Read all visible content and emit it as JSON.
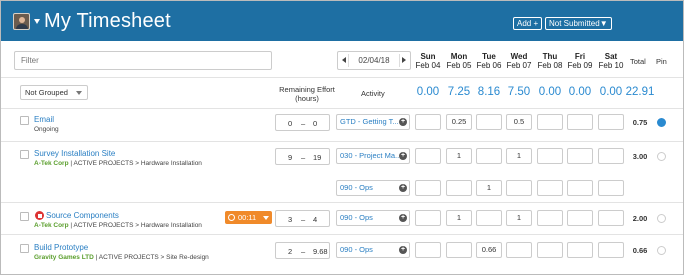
{
  "header": {
    "title": "My Timesheet",
    "add_label": "Add +",
    "status_label": "Not Submitted▼"
  },
  "toolbar": {
    "filter_placeholder": "Filter",
    "date": "02/04/18"
  },
  "days": [
    {
      "name": "Sun",
      "date": "Feb 04",
      "total": "0.00"
    },
    {
      "name": "Mon",
      "date": "Feb 05",
      "total": "7.25"
    },
    {
      "name": "Tue",
      "date": "Feb 06",
      "total": "8.16"
    },
    {
      "name": "Wed",
      "date": "Feb 07",
      "total": "7.50"
    },
    {
      "name": "Thu",
      "date": "Feb 08",
      "total": "0.00"
    },
    {
      "name": "Fri",
      "date": "Feb 09",
      "total": "0.00"
    },
    {
      "name": "Sat",
      "date": "Feb 10",
      "total": "0.00"
    }
  ],
  "columns": {
    "total": "Total",
    "pin": "Pin",
    "remaining": "Remaining Effort",
    "remaining_unit": "(hours)",
    "activity": "Activity",
    "grouping": "Not Grouped"
  },
  "grand_total": "22.91",
  "rows": [
    {
      "task": "Email",
      "sub_client": "",
      "sub_path": "Ongoing",
      "rem_a": "0",
      "rem_b": "0",
      "activities": [
        {
          "label": "GTD - Getting T...",
          "values": [
            "",
            "0.25",
            "",
            "0.5",
            "",
            "",
            ""
          ]
        }
      ],
      "total": "0.75",
      "pinned": true
    },
    {
      "task": "Survey Installation Site",
      "sub_client": "A-Tek Corp",
      "sub_path": " | ACTIVE PROJECTS > Hardware Installation",
      "rem_a": "9",
      "rem_b": "19",
      "activities": [
        {
          "label": "030 - Project Ma...",
          "values": [
            "",
            "1",
            "",
            "1",
            "",
            "",
            ""
          ]
        },
        {
          "label": "090 - Ops",
          "values": [
            "",
            "",
            "1",
            "",
            "",
            "",
            ""
          ]
        }
      ],
      "total": "3.00",
      "pinned": false
    },
    {
      "task": "Source Components",
      "sub_client": "A-Tek Corp",
      "sub_path": " | ACTIVE PROJECTS > Hardware Installation",
      "timer": "00:11",
      "rem_a": "3",
      "rem_b": "4",
      "activities": [
        {
          "label": "090 - Ops",
          "values": [
            "",
            "1",
            "",
            "1",
            "",
            "",
            ""
          ]
        }
      ],
      "total": "2.00",
      "pinned": false
    },
    {
      "task": "Build Prototype",
      "sub_client": "Gravity Games LTD",
      "sub_path": " | ACTIVE PROJECTS > Site Re-design",
      "rem_a": "2",
      "rem_b": "9.68",
      "activities": [
        {
          "label": "090 - Ops",
          "values": [
            "",
            "",
            "0.66",
            "",
            "",
            "",
            ""
          ]
        }
      ],
      "total": "0.66",
      "pinned": false
    }
  ],
  "colors": {
    "header_bg": "#1e6fa3",
    "accent": "#2a8ad0",
    "timer": "#f08a2a",
    "client": "#5a9e2c"
  }
}
